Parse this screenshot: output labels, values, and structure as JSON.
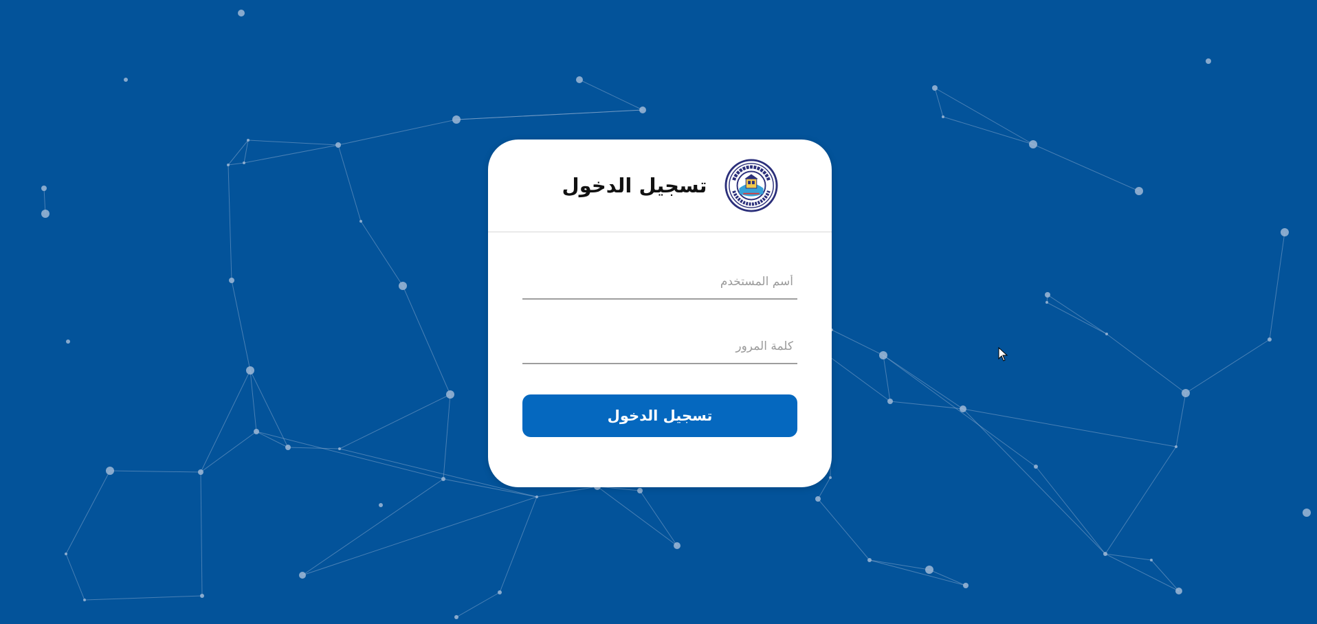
{
  "login_card": {
    "title": "تسجيل الدخول",
    "logo_icon": "suez-canal-university-seal",
    "logo_text": "SUEZ CANAL UNIVERSITY",
    "username_placeholder": "أسم المستخدم",
    "password_placeholder": "كلمة المرور",
    "submit_label": "تسجيل الدخول"
  },
  "colors": {
    "background": "#03539a",
    "card": "#ffffff",
    "button": "#0568bf",
    "network_nodes": "#9fb8d6"
  }
}
